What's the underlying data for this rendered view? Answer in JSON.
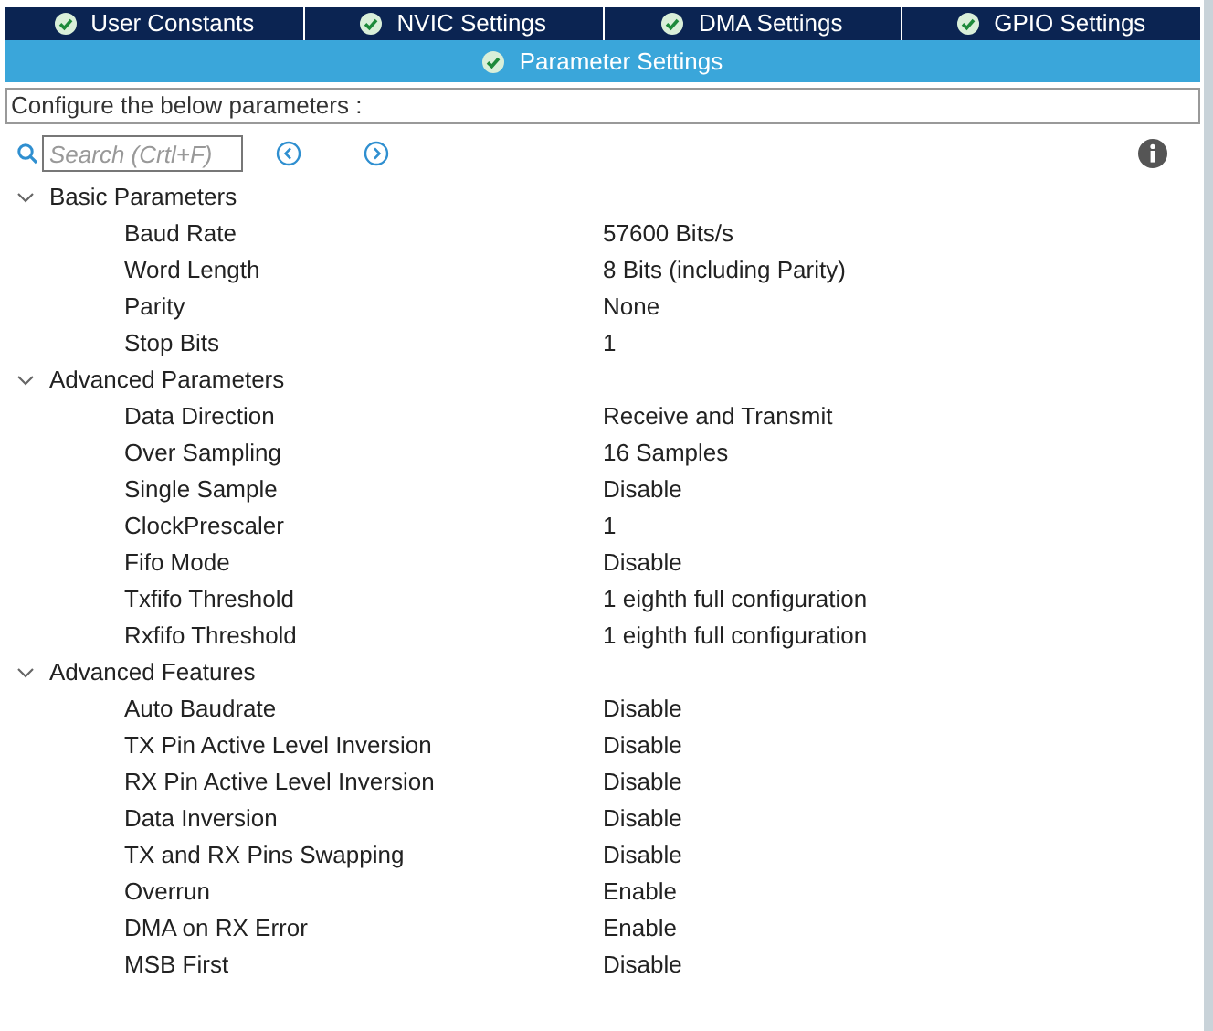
{
  "tabs": [
    {
      "label": "User Constants",
      "selected": false,
      "checked": true
    },
    {
      "label": "NVIC Settings",
      "selected": false,
      "checked": true
    },
    {
      "label": "DMA Settings",
      "selected": false,
      "checked": true
    },
    {
      "label": "GPIO Settings",
      "selected": false,
      "checked": true
    },
    {
      "label": "Parameter Settings",
      "selected": true,
      "checked": true
    }
  ],
  "description": "Configure the below parameters :",
  "search": {
    "placeholder": "Search (Crtl+F)"
  },
  "groups": [
    {
      "name": "Basic Parameters",
      "expanded": true,
      "params": [
        {
          "name": "Baud Rate",
          "value": "57600 Bits/s"
        },
        {
          "name": "Word Length",
          "value": "8 Bits (including Parity)"
        },
        {
          "name": "Parity",
          "value": "None"
        },
        {
          "name": "Stop Bits",
          "value": "1"
        }
      ]
    },
    {
      "name": "Advanced Parameters",
      "expanded": true,
      "params": [
        {
          "name": "Data Direction",
          "value": "Receive and Transmit"
        },
        {
          "name": "Over Sampling",
          "value": "16 Samples"
        },
        {
          "name": "Single Sample",
          "value": "Disable"
        },
        {
          "name": "ClockPrescaler",
          "value": "1"
        },
        {
          "name": "Fifo Mode",
          "value": "Disable"
        },
        {
          "name": "Txfifo Threshold",
          "value": "1 eighth full configuration"
        },
        {
          "name": "Rxfifo Threshold",
          "value": "1 eighth full configuration"
        }
      ]
    },
    {
      "name": "Advanced Features",
      "expanded": true,
      "params": [
        {
          "name": "Auto Baudrate",
          "value": "Disable"
        },
        {
          "name": "TX Pin Active Level Inversion",
          "value": "Disable"
        },
        {
          "name": "RX Pin Active Level Inversion",
          "value": "Disable"
        },
        {
          "name": "Data Inversion",
          "value": "Disable"
        },
        {
          "name": "TX and RX Pins Swapping",
          "value": "Disable"
        },
        {
          "name": "Overrun",
          "value": "Enable"
        },
        {
          "name": "DMA on RX Error",
          "value": "Enable"
        },
        {
          "name": "MSB First",
          "value": "Disable"
        }
      ]
    }
  ]
}
